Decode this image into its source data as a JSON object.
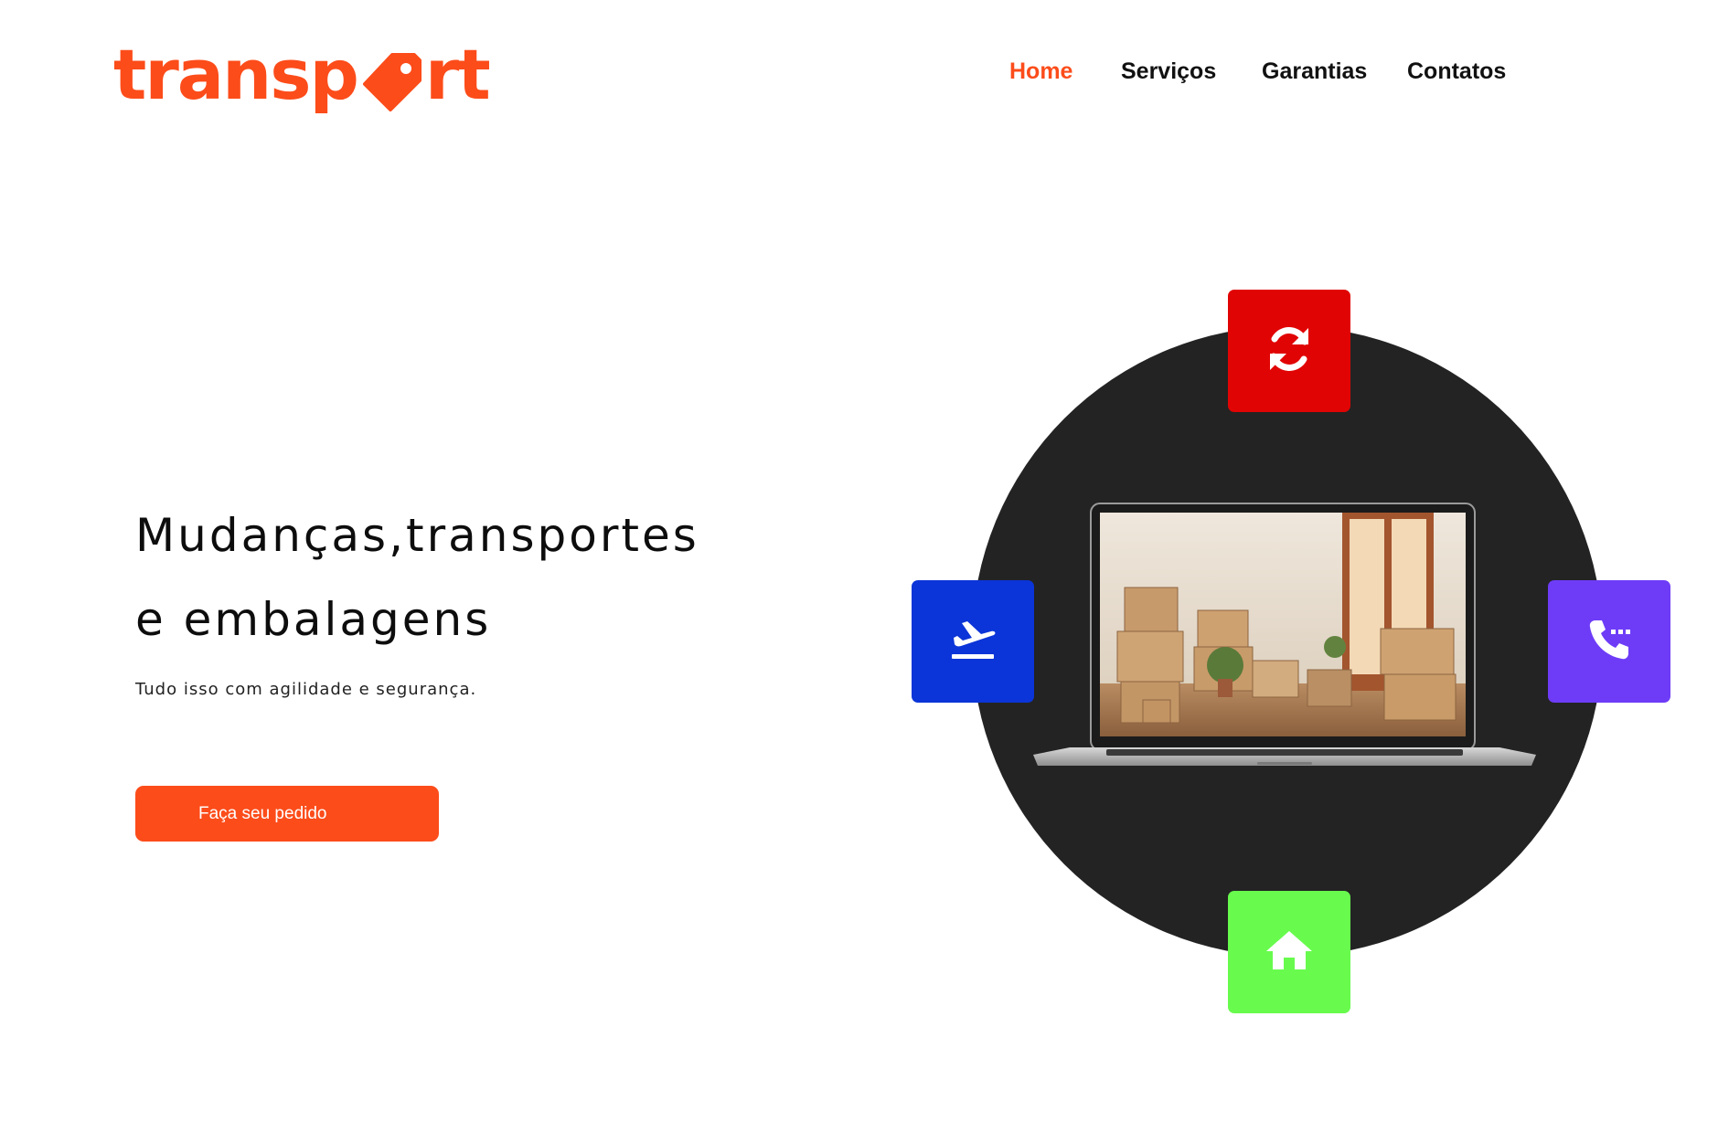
{
  "brand": {
    "logo_text_prefix": "transp",
    "logo_text_suffix": "rt",
    "color": "#fc4c1a"
  },
  "nav": {
    "items": [
      {
        "label": "Home",
        "active": true
      },
      {
        "label": "Serviços",
        "active": false
      },
      {
        "label": "Garantias",
        "active": false
      },
      {
        "label": "Contatos",
        "active": false
      }
    ]
  },
  "hero": {
    "headline_line1": "Mudanças,transportes",
    "headline_line2": "e embalagens",
    "subtitle": "Tudo isso com agilidade e segurança.",
    "cta_label": "Faça seu pedido"
  },
  "feature_tiles": [
    {
      "icon": "refresh-icon",
      "color": "#e10404"
    },
    {
      "icon": "airplane-takeoff-icon",
      "color": "#0b35d8"
    },
    {
      "icon": "phone-dots-icon",
      "color": "#6e3cf7"
    },
    {
      "icon": "home-icon",
      "color": "#68fb4e"
    }
  ],
  "colors": {
    "accent": "#fc4c1a",
    "circle": "#232323",
    "text": "#111111"
  }
}
